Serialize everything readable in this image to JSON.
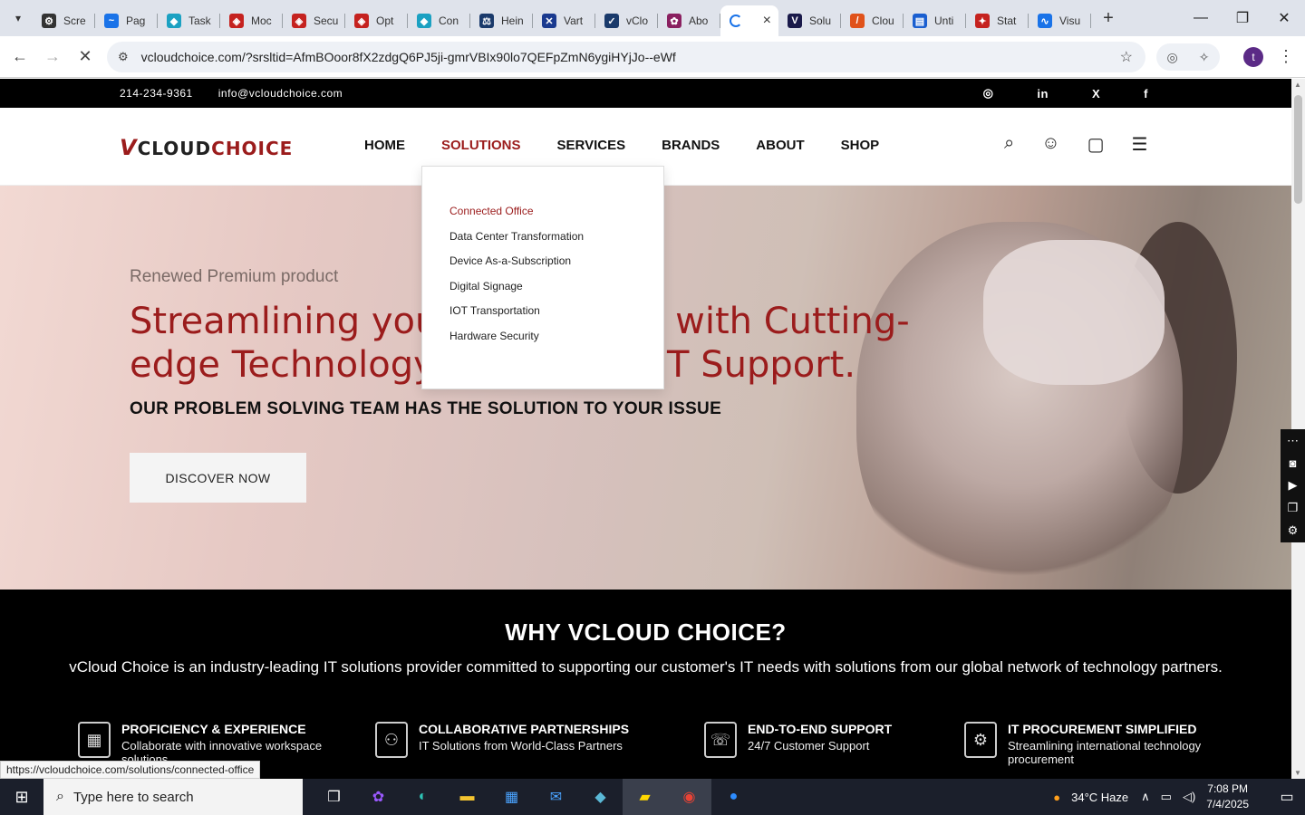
{
  "browser": {
    "tabs": [
      {
        "label": "Scre",
        "color": "#333333",
        "glyph": "⚙"
      },
      {
        "label": "Pag",
        "color": "#1a73e8",
        "glyph": "~"
      },
      {
        "label": "Task",
        "color": "#1ba1c2",
        "glyph": "◆"
      },
      {
        "label": "Moc",
        "color": "#c5221f",
        "glyph": "◈"
      },
      {
        "label": "Secu",
        "color": "#c5221f",
        "glyph": "◈"
      },
      {
        "label": "Opt",
        "color": "#c5221f",
        "glyph": "◈"
      },
      {
        "label": "Con",
        "color": "#1ba1c2",
        "glyph": "◆"
      },
      {
        "label": "Hein",
        "color": "#1a3a6b",
        "glyph": "⚖"
      },
      {
        "label": "Vart",
        "color": "#1a3a8f",
        "glyph": "✕"
      },
      {
        "label": "vClo",
        "color": "#1a3a6b",
        "glyph": "✓"
      },
      {
        "label": "Abo",
        "color": "#8a2060",
        "glyph": "✿"
      }
    ],
    "active_tab": {
      "label": "",
      "close": "×"
    },
    "tabs_after": [
      {
        "label": "Solu",
        "color": "#1a1a4a",
        "glyph": "V"
      },
      {
        "label": "Clou",
        "color": "#e0521a",
        "glyph": "/"
      },
      {
        "label": "Unti",
        "color": "#1a5fd0",
        "glyph": "▤"
      },
      {
        "label": "Stat",
        "color": "#c5221f",
        "glyph": "✦"
      },
      {
        "label": "Visu",
        "color": "#1a73e8",
        "glyph": "∿"
      }
    ],
    "new_tab": "+",
    "url": "vcloudchoice.com/?srsltid=AfmBOoor8fX2zdgQ6PJ5ji-gmrVBIx90lo7QEFpZmN6ygiHYjJo--eWf",
    "profile_initial": "t"
  },
  "topbar": {
    "phone": "214-234-9361",
    "email": "info@vcloudchoice.com",
    "socials": [
      "instagram",
      "in",
      "X",
      "f"
    ]
  },
  "header": {
    "logo_v": "V",
    "logo_cloud": "CLOUD",
    "logo_choice": "CHOICE",
    "nav": [
      "HOME",
      "SOLUTIONS",
      "SERVICES",
      "BRANDS",
      "ABOUT",
      "SHOP"
    ]
  },
  "dropdown": {
    "items": [
      "Connected Office",
      "Data Center Transformation",
      "Device As-a-Subscription",
      "Digital Signage",
      "IOT Transportation",
      "Hardware Security"
    ]
  },
  "hero": {
    "subtitle": "Renewed Premium product",
    "headline": "Streamlining your Operations with Cutting-edge Technology and Expert IT Support.",
    "tagline": "OUR PROBLEM SOLVING TEAM HAS THE SOLUTION TO YOUR ISSUE",
    "cta": "DISCOVER NOW"
  },
  "why": {
    "title": "WHY VCLOUD CHOICE?",
    "description": "vCloud Choice is an industry-leading IT solutions provider committed to supporting our customer's IT needs with solutions from our global network of technology partners.",
    "features": [
      {
        "title": "PROFICIENCY & EXPERIENCE",
        "subtitle": "Collaborate with innovative workspace solutions"
      },
      {
        "title": "COLLABORATIVE PARTNERSHIPS",
        "subtitle": "IT Solutions from World-Class Partners"
      },
      {
        "title": "END-TO-END SUPPORT",
        "subtitle": "24/7 Customer Support"
      },
      {
        "title": "IT PROCUREMENT SIMPLIFIED",
        "subtitle": "Streamlining international technology procurement"
      }
    ]
  },
  "status_url": "https://vcloudchoice.com/solutions/connected-office",
  "taskbar": {
    "search_placeholder": "Type here to search",
    "weather": "34°C  Haze",
    "time": "7:08 PM",
    "date": "7/4/2025"
  },
  "colors": {
    "brand": "#9b1c1c",
    "black": "#000000"
  }
}
